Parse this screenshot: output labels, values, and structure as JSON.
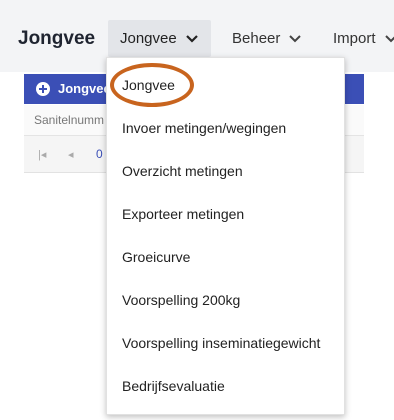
{
  "nav": {
    "brand": "Jongvee",
    "items": [
      {
        "label": "Jongvee",
        "active": true
      },
      {
        "label": "Beheer",
        "active": false
      },
      {
        "label": "Import",
        "active": false
      }
    ]
  },
  "page": {
    "add_button_label": "Jongvee",
    "column_header": "Sanitelnumm",
    "pager_number": "0"
  },
  "dropdown": {
    "items": [
      "Jongvee",
      "Invoer metingen/wegingen",
      "Overzicht metingen",
      "Exporteer metingen",
      "Groeicurve",
      "Voorspelling 200kg",
      "Voorspelling inseminatiegewicht",
      "Bedrijfsevaluatie"
    ]
  },
  "colors": {
    "accent": "#3b4fb6",
    "highlight_ring": "#c8641e",
    "topbar_bg": "#f3f4f6"
  }
}
